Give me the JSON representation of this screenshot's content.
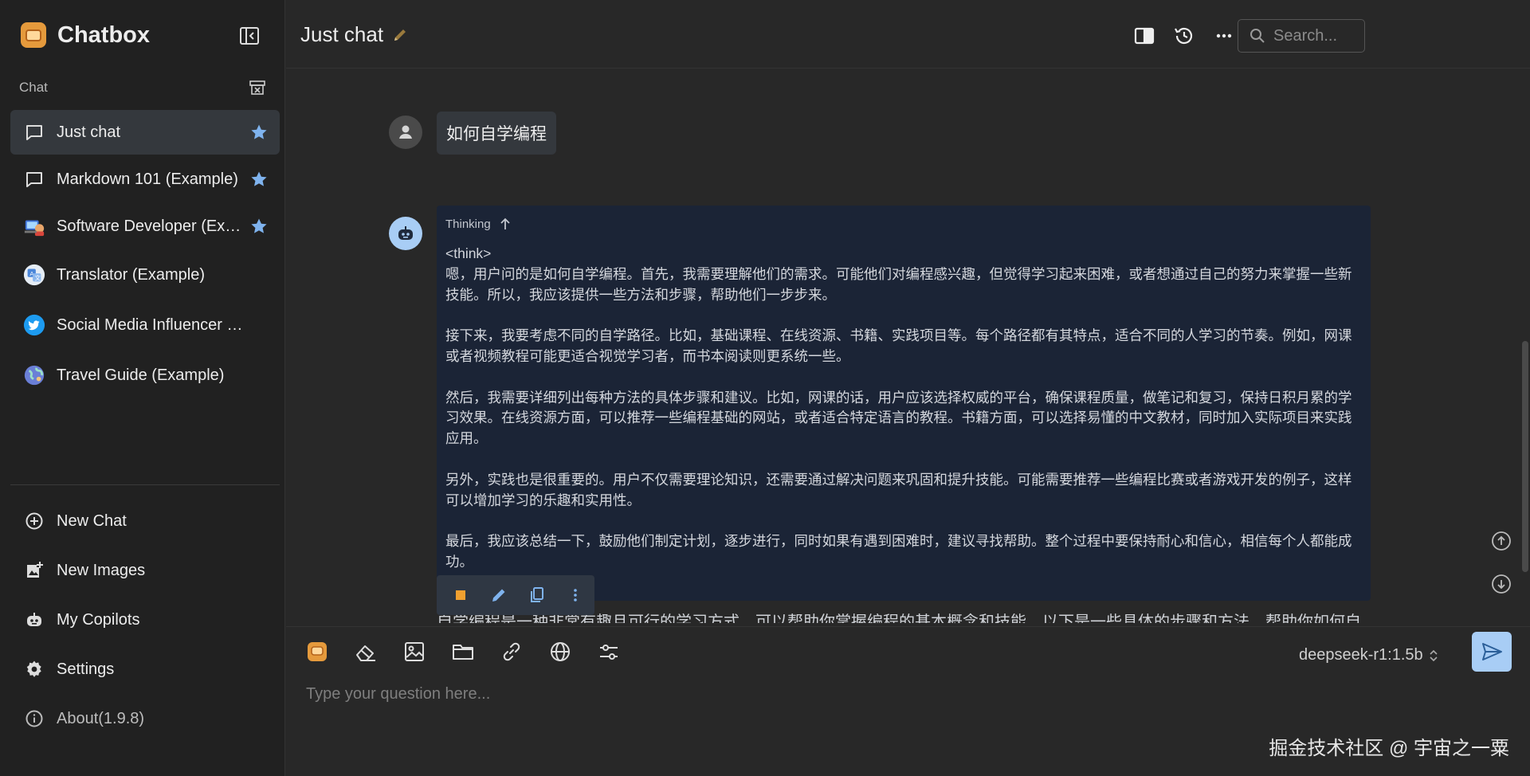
{
  "app": {
    "name": "Chatbox"
  },
  "sidebar": {
    "section_label": "Chat",
    "chats": [
      {
        "label": "Just chat",
        "icon": "chat-bubble-icon",
        "starred": true,
        "active": true
      },
      {
        "label": "Markdown 101 (Example)",
        "icon": "chat-bubble-icon",
        "starred": true,
        "active": false
      },
      {
        "label": "Software Developer (Example)",
        "icon": "software-developer-avatar",
        "starred": true,
        "active": false
      },
      {
        "label": "Translator (Example)",
        "icon": "translator-avatar",
        "starred": false,
        "active": false
      },
      {
        "label": "Social Media Influencer (Example)",
        "icon": "twitter-avatar",
        "starred": false,
        "active": false
      },
      {
        "label": "Travel Guide (Example)",
        "icon": "travel-globe-avatar",
        "starred": false,
        "active": false
      }
    ],
    "nav": [
      {
        "label": "New Chat",
        "icon": "plus-circle-icon"
      },
      {
        "label": "New Images",
        "icon": "add-image-icon"
      },
      {
        "label": "My Copilots",
        "icon": "robot-icon"
      },
      {
        "label": "Settings",
        "icon": "gear-icon"
      },
      {
        "label": "About(1.9.8)",
        "icon": "info-icon"
      }
    ]
  },
  "header": {
    "title": "Just chat",
    "search_placeholder": "Search..."
  },
  "conversation": {
    "user_message": "如何自学编程",
    "thinking_label": "Thinking",
    "thinking_text": "<think>\n嗯，用户问的是如何自学编程。首先，我需要理解他们的需求。可能他们对编程感兴趣，但觉得学习起来困难，或者想通过自己的努力来掌握一些新技能。所以，我应该提供一些方法和步骤，帮助他们一步步来。\n\n接下来，我要考虑不同的自学路径。比如，基础课程、在线资源、书籍、实践项目等。每个路径都有其特点，适合不同的人学习的节奏。例如，网课或者视频教程可能更适合视觉学习者，而书本阅读则更系统一些。\n\n然后，我需要详细列出每种方法的具体步骤和建议。比如，网课的话，用户应该选择权威的平台，确保课程质量，做笔记和复习，保持日积月累的学习效果。在线资源方面，可以推荐一些编程基础的网站，或者适合特定语言的教程。书籍方面，可以选择易懂的中文教材，同时加入实际项目来实践应用。\n\n另外，实践也是很重要的。用户不仅需要理论知识，还需要通过解决问题来巩固和提升技能。可能需要推荐一些编程比赛或者游戏开发的例子，这样可以增加学习的乐趣和实用性。\n\n最后，我应该总结一下，鼓励他们制定计划，逐步进行，同时如果有遇到困难时，建议寻找帮助。整个过程中要保持耐心和信心，相信每个人都能成功。\n</think>",
    "answer_preview": "自学编程是一种非常有趣且可行的学习方式，可以帮助你掌握编程的基本概念和技能。以下是一些具体的步骤和方法，帮助你如何自"
  },
  "composer": {
    "placeholder": "Type your question here...",
    "model": "deepseek-r1:1.5b"
  },
  "watermark": "掘金技术社区 @ 宇宙之一粟",
  "colors": {
    "accent_blue": "#7fb3ee",
    "star_blue": "#7fb3ee",
    "thinking_bg": "#1b2436",
    "send_bg": "#a8cdf5",
    "stop_orange": "#f0a030"
  }
}
